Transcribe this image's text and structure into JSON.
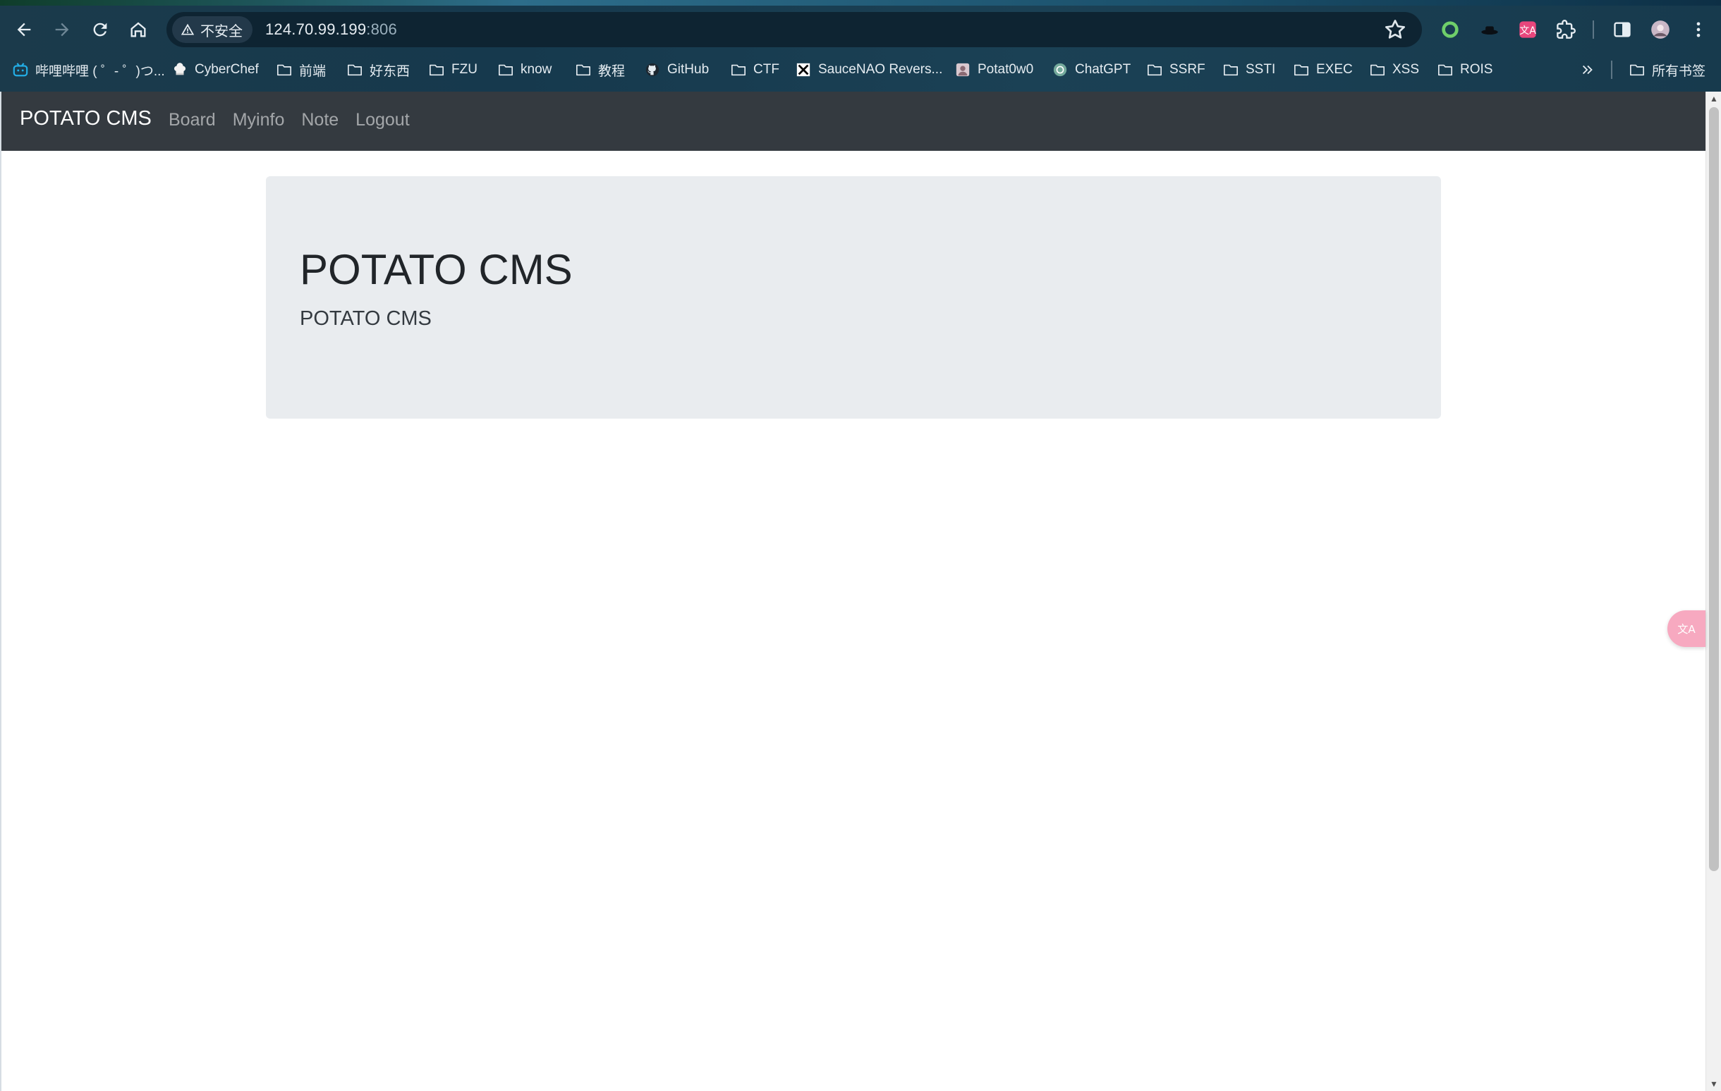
{
  "browser": {
    "security_label": "不安全",
    "url_host": "124.70.99.199",
    "url_port": ":806"
  },
  "bookmarks": [
    {
      "label": "哔哩哔哩 ( ゜- ゜)つ...",
      "icon": "bilibili-icon"
    },
    {
      "label": "CyberChef",
      "icon": "chef-hat-icon"
    },
    {
      "label": "前端",
      "icon": "folder-icon"
    },
    {
      "label": "好东西",
      "icon": "folder-icon"
    },
    {
      "label": "FZU",
      "icon": "folder-icon"
    },
    {
      "label": "know",
      "icon": "folder-icon"
    },
    {
      "label": "教程",
      "icon": "folder-icon"
    },
    {
      "label": "GitHub",
      "icon": "github-icon"
    },
    {
      "label": "CTF",
      "icon": "folder-icon"
    },
    {
      "label": "SauceNAO Revers...",
      "icon": "saucenao-icon"
    },
    {
      "label": "Potat0w0",
      "icon": "avatar-icon"
    },
    {
      "label": "ChatGPT",
      "icon": "chatgpt-icon"
    },
    {
      "label": "SSRF",
      "icon": "folder-icon"
    },
    {
      "label": "SSTI",
      "icon": "folder-icon"
    },
    {
      "label": "EXEC",
      "icon": "folder-icon"
    },
    {
      "label": "XSS",
      "icon": "folder-icon"
    },
    {
      "label": "ROIS",
      "icon": "folder-icon"
    }
  ],
  "all_bookmarks_label": "所有书签",
  "site": {
    "brand": "POTATO CMS",
    "nav": [
      "Board",
      "Myinfo",
      "Note",
      "Logout"
    ],
    "jumbotron": {
      "title": "POTATO CMS",
      "lead": "POTATO CMS"
    }
  },
  "colors": {
    "navbar_bg": "#343a40",
    "jumbotron_bg": "#e9ecef"
  }
}
